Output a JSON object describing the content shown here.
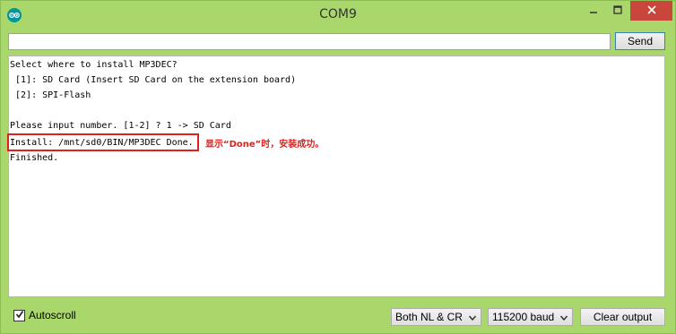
{
  "window": {
    "title": "COM9"
  },
  "send": {
    "input_value": "",
    "button_label": "Send"
  },
  "output": {
    "lines": [
      "Select where to install MP3DEC?",
      " [1]: SD Card (Insert SD Card on the extension board)",
      " [2]: SPI-Flash",
      "",
      "Please input number. [1-2] ? 1 -> SD Card",
      "Install: /mnt/sd0/BIN/MP3DEC Done.",
      "Finished."
    ],
    "annotation": "显示“Done”时，安装成功。"
  },
  "footer": {
    "autoscroll_label": "Autoscroll",
    "autoscroll_checked": true,
    "line_ending": "Both NL & CR",
    "baud_rate": "115200 baud",
    "clear_label": "Clear output"
  },
  "colors": {
    "frame": "#a9d76b",
    "close_button": "#c9463d",
    "annotation_red": "#e0201c",
    "arduino_teal": "#00979c"
  },
  "icons": [
    "arduino-logo-icon",
    "minimize-icon",
    "maximize-icon",
    "close-icon",
    "checkmark-icon",
    "chevron-down-icon"
  ]
}
